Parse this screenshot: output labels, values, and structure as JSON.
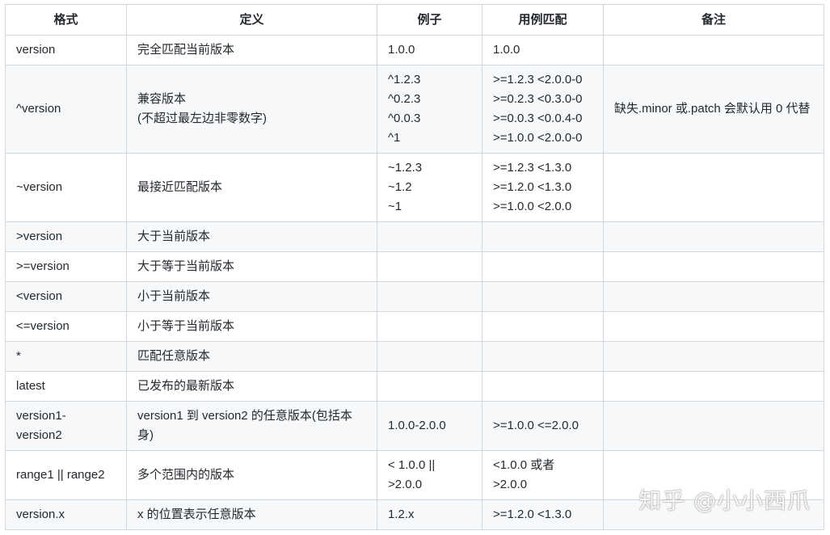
{
  "headers": [
    "格式",
    "定义",
    "例子",
    "用例匹配",
    "备注"
  ],
  "rows": [
    {
      "format": [
        "version"
      ],
      "definition": [
        "完全匹配当前版本"
      ],
      "example": [
        "1.0.0"
      ],
      "match": [
        "1.0.0"
      ],
      "note": ""
    },
    {
      "format": [
        "^version"
      ],
      "definition": [
        "兼容版本",
        "(不超过最左边非零数字)"
      ],
      "example": [
        "^1.2.3",
        "^0.2.3",
        "^0.0.3",
        "^1"
      ],
      "match": [
        ">=1.2.3 <2.0.0-0",
        ">=0.2.3 <0.3.0-0",
        ">=0.0.3 <0.0.4-0",
        ">=1.0.0 <2.0.0-0"
      ],
      "note": "缺失.minor 或.patch 会默认用 0 代替"
    },
    {
      "format": [
        "~version"
      ],
      "definition": [
        "最接近匹配版本"
      ],
      "example": [
        "~1.2.3",
        "~1.2",
        "~1"
      ],
      "match": [
        ">=1.2.3 <1.3.0",
        ">=1.2.0 <1.3.0",
        ">=1.0.0 <2.0.0"
      ],
      "note": ""
    },
    {
      "format": [
        ">version"
      ],
      "definition": [
        "大于当前版本"
      ],
      "example": [],
      "match": [],
      "note": ""
    },
    {
      "format": [
        ">=version"
      ],
      "definition": [
        "大于等于当前版本"
      ],
      "example": [],
      "match": [],
      "note": ""
    },
    {
      "format": [
        "<version"
      ],
      "definition": [
        "小于当前版本"
      ],
      "example": [],
      "match": [],
      "note": ""
    },
    {
      "format": [
        "<=version"
      ],
      "definition": [
        "小于等于当前版本"
      ],
      "example": [],
      "match": [],
      "note": ""
    },
    {
      "format": [
        "*"
      ],
      "definition": [
        "匹配任意版本"
      ],
      "example": [],
      "match": [],
      "note": ""
    },
    {
      "format": [
        "latest"
      ],
      "definition": [
        "已发布的最新版本"
      ],
      "example": [],
      "match": [],
      "note": ""
    },
    {
      "format": [
        "version1-",
        "version2"
      ],
      "definition": [
        "version1 到 version2 的任意版本(包括本",
        "身)"
      ],
      "example": [
        "1.0.0-2.0.0"
      ],
      "match": [
        ">=1.0.0 <=2.0.0"
      ],
      "note": ""
    },
    {
      "format": [
        "range1 || range2"
      ],
      "definition": [
        "多个范围内的版本"
      ],
      "example": [
        "< 1.0.0 ||",
        ">2.0.0"
      ],
      "match": [
        "<1.0.0 或者",
        ">2.0.0"
      ],
      "note": ""
    },
    {
      "format": [
        "version.x"
      ],
      "definition": [
        "x 的位置表示任意版本"
      ],
      "example": [
        "1.2.x"
      ],
      "match": [
        ">=1.2.0 <1.3.0"
      ],
      "note": ""
    }
  ],
  "watermark": "知乎 @小小西爪"
}
